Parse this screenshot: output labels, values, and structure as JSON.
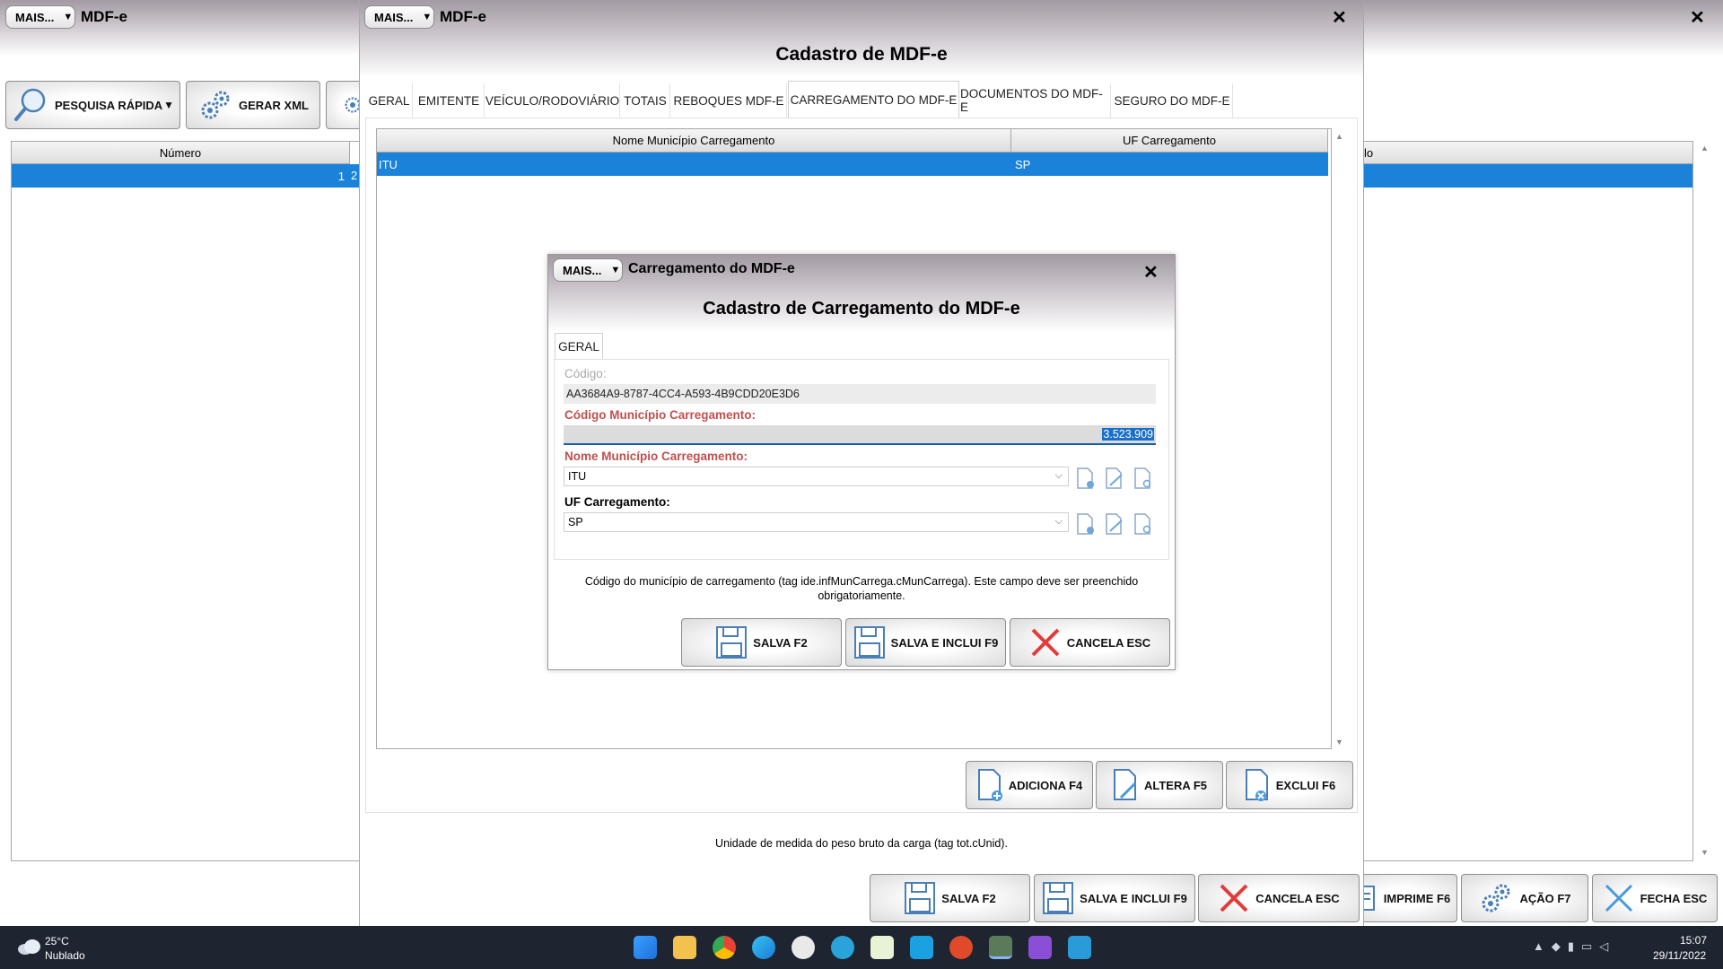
{
  "bg_window": {
    "mais": "MAIS...",
    "title": "MDF-e",
    "close": "✕",
    "toolbar": {
      "quick_search": "PESQUISA RÁPIDA",
      "gen_xml": "GERAR XML"
    },
    "grid": {
      "col_numero": "Número",
      "col_partial": "lo",
      "row_value": "1",
      "row_value2": "2"
    },
    "buttons": {
      "print": "IMPRIME F6",
      "action": "AÇÃO F7",
      "close": "FECHA ESC"
    }
  },
  "mid_window": {
    "mais": "MAIS...",
    "title": "MDF-e",
    "close": "✕",
    "heading": "Cadastro de MDF-e",
    "tabs": [
      "GERAL",
      "EMITENTE",
      "VEÍCULO/RODOVIÁRIO",
      "TOTAIS",
      "REBOQUES MDF-E",
      "CARREGAMENTO DO MDF-E",
      "DOCUMENTOS DO MDF-E",
      "SEGURO DO MDF-E"
    ],
    "active_tab_index": 5,
    "grid": {
      "columns": [
        "Nome Município Carregamento",
        "UF Carregamento"
      ],
      "rows": [
        [
          "ITU",
          "SP"
        ]
      ]
    },
    "grid_buttons": {
      "add": "ADICIONA F4",
      "edit": "ALTERA F5",
      "delete": "EXCLUI F6"
    },
    "hint": "Unidade de medida do peso bruto da carga (tag tot.cUnid).",
    "buttons": {
      "save": "SALVA F2",
      "save_add": "SALVA E INCLUI F9",
      "cancel": "CANCELA ESC"
    }
  },
  "dialog": {
    "mais": "MAIS...",
    "title": "Carregamento do MDF-e",
    "close": "✕",
    "heading": "Cadastro de Carregamento do MDF-e",
    "tab": "GERAL",
    "fields": {
      "codigo_label": "Código:",
      "codigo_value": "AA3684A9-8787-4CC4-A593-4B9CDD20E3D6",
      "cod_mun_label": "Código Município Carregamento:",
      "cod_mun_value": "3.523.909",
      "nome_mun_label": "Nome Município Carregamento:",
      "nome_mun_value": "ITU",
      "uf_label": "UF Carregamento:",
      "uf_value": "SP"
    },
    "hint_line1": "Código do município de carregamento (tag ide.infMunCarrega.cMunCarrega). Este campo deve ser preenchido",
    "hint_line2": "obrigatoriamente.",
    "buttons": {
      "save": "SALVA F2",
      "save_add": "SALVA E INCLUI F9",
      "cancel": "CANCELA ESC"
    }
  },
  "taskbar": {
    "weather_temp": "25°C",
    "weather_desc": "Nublado",
    "time": "15:07",
    "date": "29/11/2022",
    "colors": {
      "bg": "#1e2430",
      "accent_blue": "#1a82d9",
      "required_red": "#c0504d"
    }
  }
}
